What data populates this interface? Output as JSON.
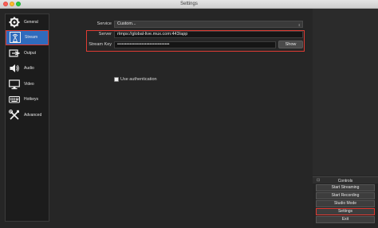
{
  "window": {
    "title": "Settings"
  },
  "sidebar": {
    "items": [
      {
        "label": "General",
        "active": false
      },
      {
        "label": "Stream",
        "active": true
      },
      {
        "label": "Output",
        "active": false
      },
      {
        "label": "Audio",
        "active": false
      },
      {
        "label": "Video",
        "active": false
      },
      {
        "label": "Hotkeys",
        "active": false
      },
      {
        "label": "Advanced",
        "active": false
      }
    ]
  },
  "stream": {
    "service_label": "Service",
    "service_value": "Custom...",
    "server_label": "Server",
    "server_value": "rtmps://global-live.mux.com:443/app",
    "key_label": "Stream Key",
    "key_value": "••••••••••••••••••••••••••••••••••",
    "show_label": "Show",
    "auth_label": "Use authentication",
    "auth_checked": false
  },
  "controls": {
    "title": "Controls",
    "buttons": [
      "Start Streaming",
      "Start Recording",
      "Studio Mode",
      "Settings",
      "Exit"
    ]
  },
  "colors": {
    "accent": "#2f6bbd",
    "highlight": "#e03b33"
  }
}
